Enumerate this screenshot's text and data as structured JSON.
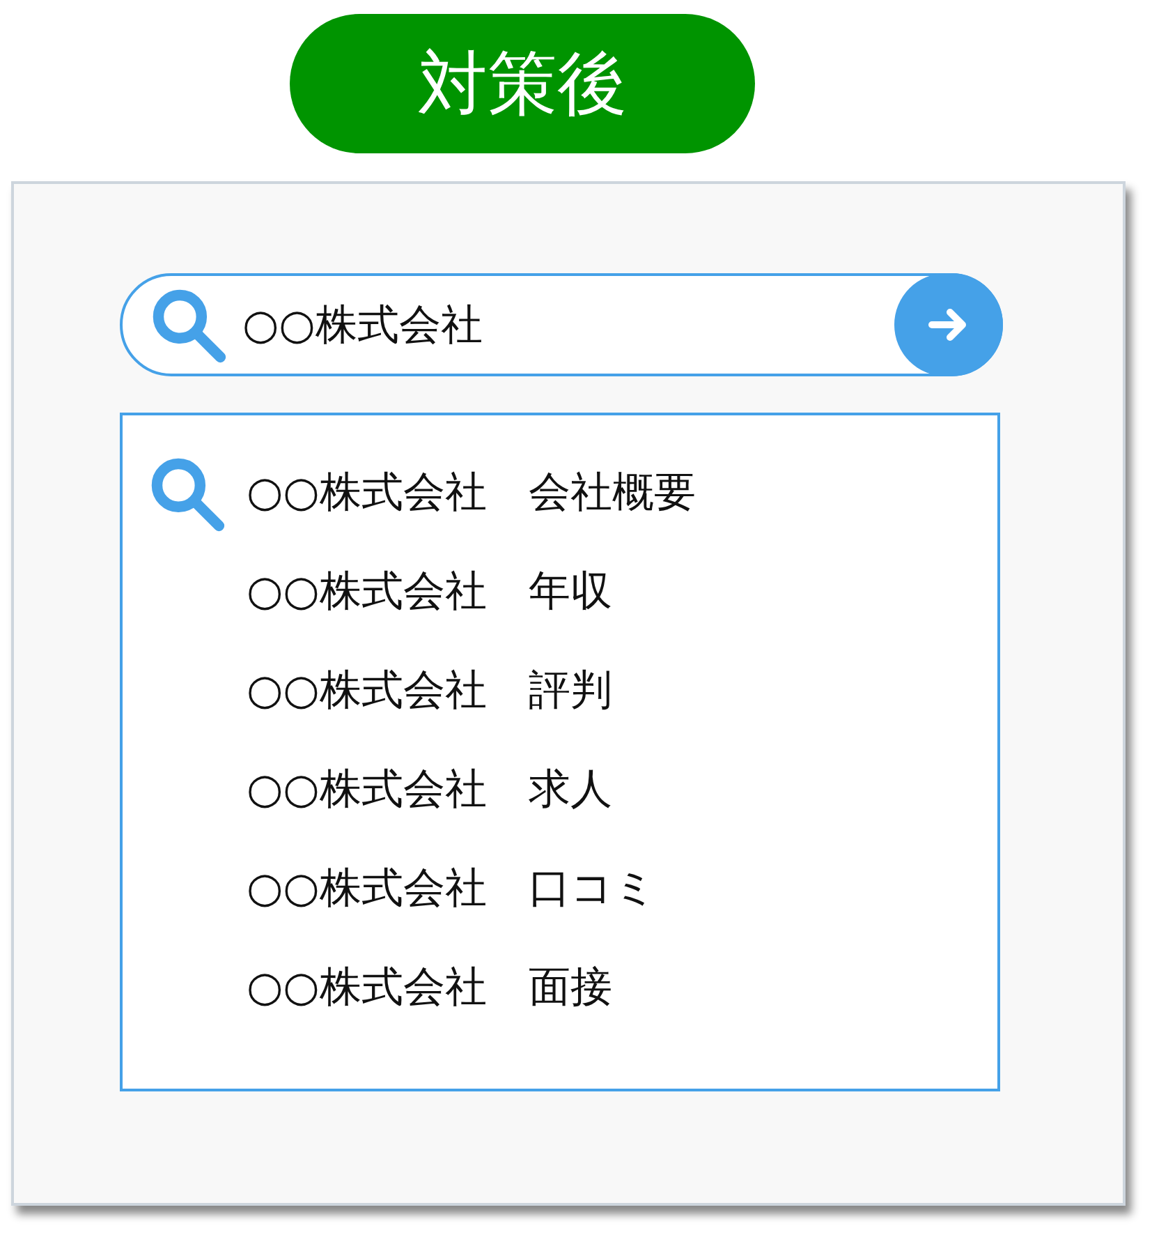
{
  "badge": {
    "label": "対策後"
  },
  "search": {
    "value": "○○株式会社"
  },
  "suggestions": [
    {
      "text": "○○株式会社　会社概要",
      "has_icon": true
    },
    {
      "text": "○○株式会社　年収",
      "has_icon": false
    },
    {
      "text": "○○株式会社　評判",
      "has_icon": false
    },
    {
      "text": "○○株式会社　求人",
      "has_icon": false
    },
    {
      "text": "○○株式会社　口コミ",
      "has_icon": false
    },
    {
      "text": "○○株式会社　面接",
      "has_icon": false
    }
  ]
}
